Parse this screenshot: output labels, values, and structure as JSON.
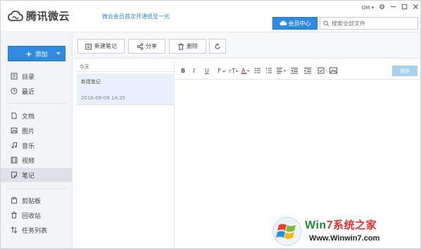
{
  "header": {
    "app_name": "腾讯微云",
    "promo_text": "微云会员首次开通低至一元",
    "vip_label": "会员中心",
    "search_placeholder": "搜索全部文件",
    "user_label": "QM"
  },
  "sidebar": {
    "add_label": "添加",
    "items": [
      {
        "label": "目录",
        "icon": "catalog-icon"
      },
      {
        "label": "最近",
        "icon": "clock-icon"
      },
      {
        "label": "文档",
        "icon": "document-icon"
      },
      {
        "label": "图片",
        "icon": "picture-icon"
      },
      {
        "label": "音乐",
        "icon": "music-icon"
      },
      {
        "label": "视频",
        "icon": "video-icon"
      },
      {
        "label": "笔记",
        "icon": "note-icon",
        "active": true
      },
      {
        "label": "剪贴板",
        "icon": "clipboard-icon"
      },
      {
        "label": "回收站",
        "icon": "trash-icon"
      },
      {
        "label": "任务列表",
        "icon": "transfer-icon"
      }
    ]
  },
  "toolbar": {
    "new_note": "新建笔记",
    "share": "分享",
    "delete": "删除"
  },
  "notes": {
    "section": "今天",
    "items": [
      {
        "title": "新建笔记",
        "date": "2016-08-09 14:35"
      }
    ]
  },
  "editor": {
    "save_label": "保存",
    "format_buttons": [
      "B",
      "I",
      "U"
    ]
  },
  "watermark": {
    "brand_a": "Win",
    "brand_b": "7",
    "brand_c": "系统之家",
    "url": "Www.Winwin7.com"
  },
  "colors": {
    "accent": "#2f8be0",
    "sidebar_bg": "#f2f4f7",
    "selected_note": "#e8f1fb",
    "save_disabled": "#a9cff2"
  }
}
